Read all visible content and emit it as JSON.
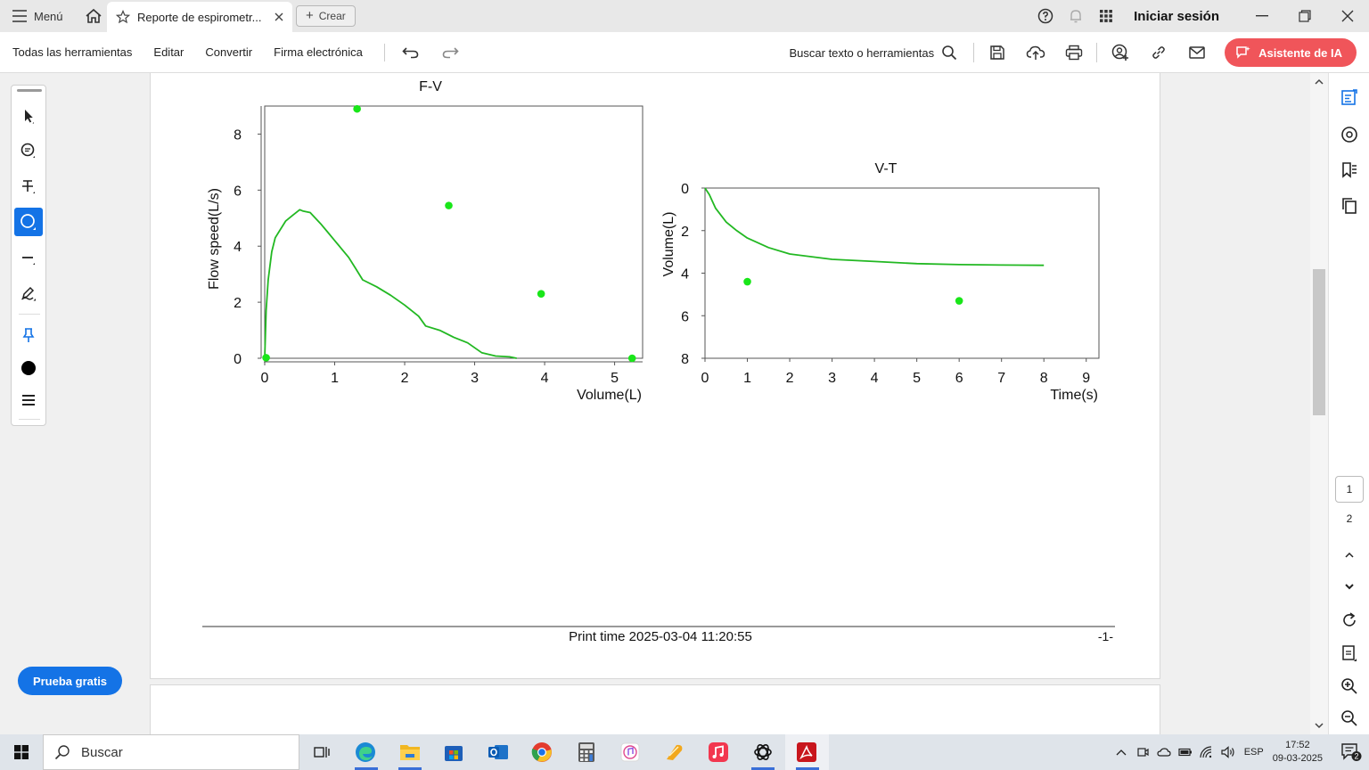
{
  "titlebar": {
    "menu_label": "Menú",
    "tab_title": "Reporte de espirometr...",
    "new_label": "Crear",
    "signin_label": "Iniciar sesión"
  },
  "toolbar": {
    "all_tools": "Todas las herramientas",
    "edit": "Editar",
    "convert": "Convertir",
    "esign": "Firma electrónica",
    "search_label": "Buscar texto o herramientas",
    "ai_label": "Asistente de IA"
  },
  "left_panel": {
    "trial_label": "Prueba gratis",
    "active_tool": "ellipse-tool"
  },
  "page": {
    "footer_text": "Print time 2025-03-04 11:20:55",
    "page_marker": "-1-"
  },
  "navigation": {
    "current_page": "1",
    "total_pages": "2"
  },
  "taskbar": {
    "search_placeholder": "Buscar",
    "language": "ESP",
    "time": "17:52",
    "date": "09-03-2025",
    "notification_count": "2"
  },
  "colors": {
    "accent": "#1473e6",
    "ai_button": "#f0555a",
    "curve": "#22b822",
    "point": "#19e619"
  },
  "chart_data": [
    {
      "type": "line",
      "title": "F-V",
      "xlabel": "Volume(L)",
      "ylabel": "Flow speed(L/s)",
      "xlim": [
        0,
        5.4
      ],
      "ylim": [
        0,
        9
      ],
      "xticks": [
        0,
        1,
        2,
        3,
        4,
        5
      ],
      "yticks": [
        0,
        2,
        4,
        6,
        8
      ],
      "series": [
        {
          "kind": "line",
          "x": [
            0,
            0.02,
            0.05,
            0.1,
            0.15,
            0.2,
            0.3,
            0.4,
            0.5,
            0.55,
            0.65,
            0.8,
            0.9,
            1.0,
            1.1,
            1.2,
            1.3,
            1.4,
            1.6,
            1.8,
            2.0,
            2.2,
            2.3,
            2.5,
            2.7,
            2.9,
            3.1,
            3.3,
            3.5,
            3.6
          ],
          "y": [
            0,
            1.7,
            2.8,
            3.8,
            4.3,
            4.5,
            4.9,
            5.1,
            5.3,
            5.25,
            5.2,
            4.8,
            4.5,
            4.2,
            3.9,
            3.6,
            3.2,
            2.8,
            2.55,
            2.25,
            1.9,
            1.5,
            1.15,
            1.0,
            0.75,
            0.55,
            0.2,
            0.08,
            0.05,
            0.0
          ]
        },
        {
          "kind": "scatter",
          "x": [
            0.02,
            1.32,
            2.63,
            3.95,
            5.25
          ],
          "y": [
            0.02,
            8.9,
            5.45,
            2.3,
            0.0
          ]
        }
      ]
    },
    {
      "type": "line",
      "title": "V-T",
      "xlabel": "Time(s)",
      "ylabel": "Volume(L)",
      "xlim": [
        0,
        9.3
      ],
      "ylim": [
        0,
        8
      ],
      "y_inverted": true,
      "xticks": [
        0,
        1,
        2,
        3,
        4,
        5,
        6,
        7,
        8,
        9
      ],
      "yticks": [
        0,
        2,
        4,
        6,
        8
      ],
      "series": [
        {
          "kind": "line",
          "x": [
            0,
            0.1,
            0.25,
            0.5,
            0.75,
            1.0,
            1.5,
            2.0,
            3.0,
            4.0,
            5.0,
            6.0,
            7.0,
            8.0
          ],
          "y": [
            0,
            0.3,
            0.95,
            1.6,
            2.0,
            2.35,
            2.8,
            3.1,
            3.35,
            3.45,
            3.55,
            3.6,
            3.62,
            3.63
          ]
        },
        {
          "kind": "scatter",
          "x": [
            1.0,
            6.0
          ],
          "y": [
            4.4,
            5.3
          ]
        }
      ]
    }
  ]
}
